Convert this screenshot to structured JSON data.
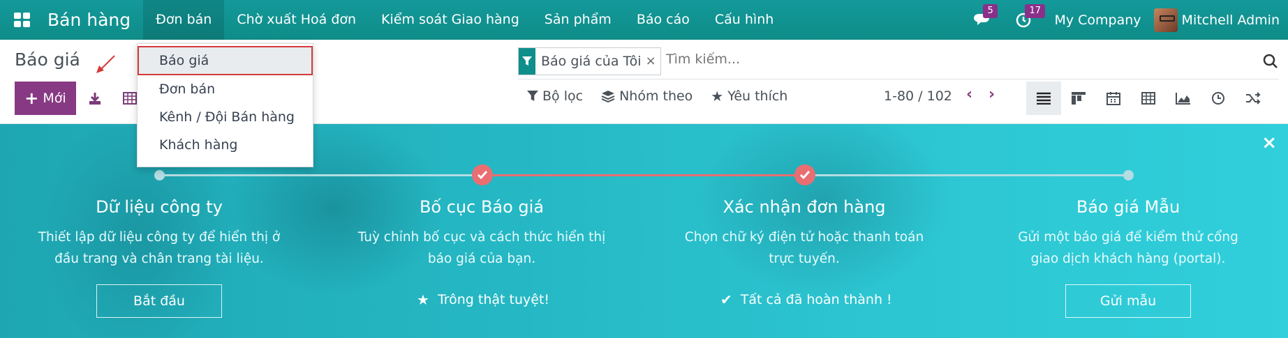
{
  "navbar": {
    "app_name": "Bán hàng",
    "menu": [
      "Đơn bán",
      "Chờ xuất Hoá đơn",
      "Kiểm soát Giao hàng",
      "Sản phẩm",
      "Báo cáo",
      "Cấu hình"
    ],
    "chat_badge": "5",
    "activity_badge": "17",
    "company": "My Company",
    "user": "Mitchell Admin"
  },
  "control": {
    "title": "Báo giá",
    "new_label": "Mới",
    "facet_label": "Báo giá của Tôi",
    "facet_close": "×",
    "search_placeholder": "Tìm kiếm...",
    "filters": "Bộ lọc",
    "group_by": "Nhóm theo",
    "favorites": "Yêu thích",
    "pager": "1-80 / 102"
  },
  "dropdown": [
    "Báo giá",
    "Đơn bán",
    "Kênh / Đội Bán hàng",
    "Khách hàng"
  ],
  "banner": {
    "steps": [
      {
        "title": "Dữ liệu công ty",
        "desc1": "Thiết lập dữ liệu công ty để hiển thị ở",
        "desc2": "đầu trang và chân trang tài liệu.",
        "action": "Bắt đầu"
      },
      {
        "title": "Bố cục Báo giá",
        "desc1": "Tuỳ chỉnh bố cục và cách thức hiển thị",
        "desc2": "báo giá của bạn.",
        "action": "Trông thật tuyệt!"
      },
      {
        "title": "Xác nhận đơn hàng",
        "desc1": "Chọn chữ ký điện tử hoặc thanh toán",
        "desc2": "trực tuyến.",
        "action": "Tất cả đã hoàn thành !"
      },
      {
        "title": "Báo giá Mẫu",
        "desc1": "Gửi một báo giá để kiểm thử cổng",
        "desc2": "giao dịch khách hàng (portal).",
        "action": "Gửi mẫu"
      }
    ],
    "close": "×"
  },
  "colors": {
    "navbar": "#0f8f8b",
    "primary": "#873a83",
    "check": "#e96e72",
    "highlight": "#d33a3a"
  }
}
